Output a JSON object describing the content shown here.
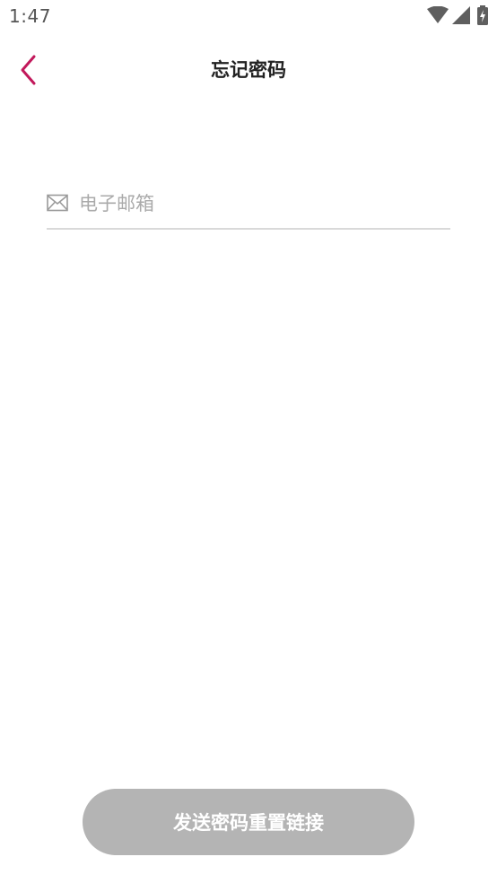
{
  "status_bar": {
    "time": "1:47",
    "icons": [
      "wifi-icon",
      "cell-signal-icon",
      "battery-charging-icon"
    ]
  },
  "header": {
    "title": "忘记密码",
    "back_icon": "chevron-left-icon",
    "accent_color": "#c2185b"
  },
  "form": {
    "email_placeholder": "电子邮箱",
    "email_value": "",
    "email_icon": "mail-icon"
  },
  "actions": {
    "send_reset_label": "发送密码重置链接",
    "send_reset_state": "disabled",
    "button_color": "#b4b4b4"
  }
}
